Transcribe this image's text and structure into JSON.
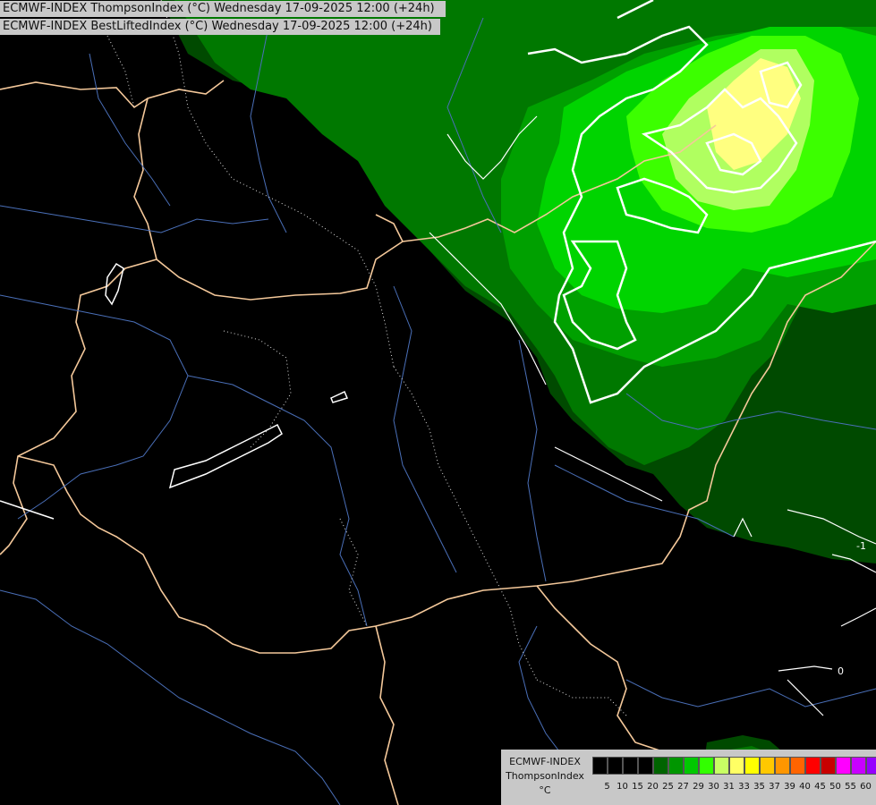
{
  "header": {
    "line1": "ECMWF-INDEX ThompsonIndex (°C) Wednesday 17-09-2025 12:00 (+24h)",
    "line2": "ECMWF-INDEX BestLiftedIndex (°C) Wednesday 17-09-2025 12:00 (+24h)"
  },
  "map": {
    "contour_labels": [
      "-1",
      "0"
    ]
  },
  "legend": {
    "source": "ECMWF-INDEX",
    "parameter": "ThompsonIndex",
    "unit": "°C",
    "ticks": [
      "5",
      "10",
      "15",
      "20",
      "25",
      "27",
      "29",
      "30",
      "31",
      "33",
      "35",
      "37",
      "39",
      "40",
      "45",
      "50",
      "55",
      "60"
    ],
    "colors": [
      "#000000",
      "#000000",
      "#000000",
      "#000000",
      "#006400",
      "#009600",
      "#00c800",
      "#32ff00",
      "#c8ff64",
      "#ffff64",
      "#ffff00",
      "#ffc800",
      "#ff9600",
      "#ff6400",
      "#ff0000",
      "#c80000",
      "#ff00ff",
      "#c800ff",
      "#9600ff",
      "#6400ff",
      "#0000ff"
    ]
  }
}
